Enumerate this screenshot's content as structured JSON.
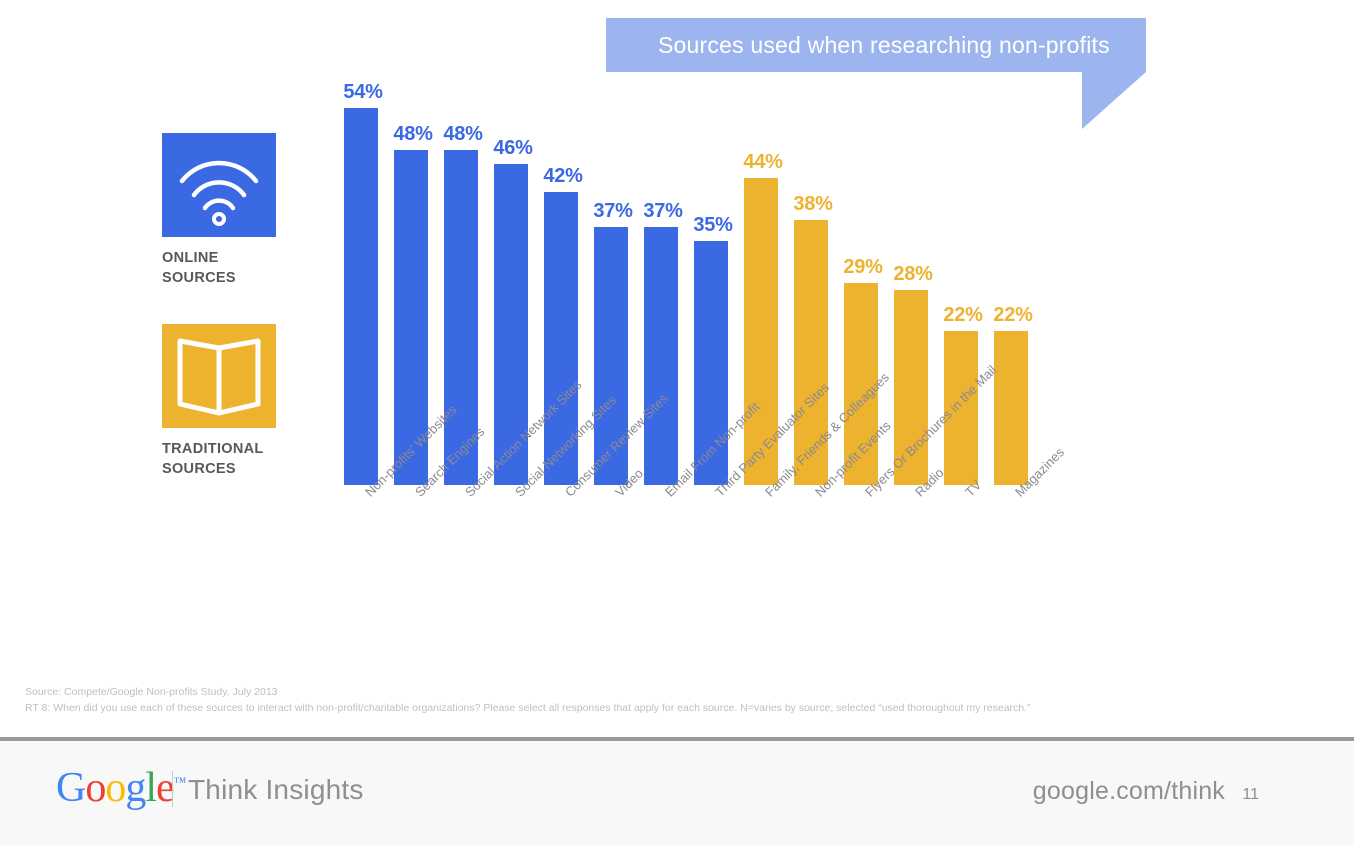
{
  "title": {
    "text": "Sources used when researching non-profits",
    "banner_color": "#9CB5EF",
    "text_color": "#FFFFFF"
  },
  "legend": {
    "items": [
      {
        "id": "online",
        "label": "ONLINE\nSOURCES",
        "icon": "wifi-icon",
        "color": "#3B68E3"
      },
      {
        "id": "traditional",
        "label": "TRADITIONAL\nSOURCES",
        "icon": "open-book-icon",
        "color": "#EDB22E"
      }
    ]
  },
  "chart_data": {
    "type": "bar",
    "title": "Sources used when researching non-profits",
    "xlabel": "",
    "ylabel": "",
    "ylim": [
      0,
      60
    ],
    "grid": false,
    "legend_position": "left",
    "value_suffix": "%",
    "categories": [
      "Non-profits' Websites",
      "Search Engines",
      "Social Action Network Sites",
      "Social Networking Sites",
      "Consumer Review Sites",
      "Video",
      "Email From Non-profit",
      "Third Party Evaluator Sites",
      "Family, Friends & Colleagues",
      "Non-profit Events",
      "Flyers Or Brochures in the Mail",
      "Radio",
      "TV",
      "Magazines"
    ],
    "values": [
      54,
      48,
      48,
      46,
      42,
      37,
      37,
      35,
      44,
      38,
      29,
      28,
      22,
      22
    ],
    "value_labels": [
      "54%",
      "48%",
      "48%",
      "46%",
      "42%",
      "37%",
      "37%",
      "35%",
      "44%",
      "38%",
      "29%",
      "28%",
      "22%",
      "22%"
    ],
    "groups": [
      "online",
      "online",
      "online",
      "online",
      "online",
      "online",
      "online",
      "online",
      "traditional",
      "traditional",
      "traditional",
      "traditional",
      "traditional",
      "traditional"
    ],
    "series": [
      {
        "name": "Online Sources",
        "color": "#3B68E3",
        "categories": [
          "Non-profits' Websites",
          "Search Engines",
          "Social Action Network Sites",
          "Social Networking Sites",
          "Consumer Review Sites",
          "Video",
          "Email From Non-profit",
          "Third Party Evaluator Sites"
        ],
        "values": [
          54,
          48,
          48,
          46,
          42,
          37,
          37,
          35
        ]
      },
      {
        "name": "Traditional Sources",
        "color": "#EDB22E",
        "categories": [
          "Family, Friends & Colleagues",
          "Non-profit Events",
          "Flyers Or Brochures in the Mail",
          "Radio",
          "TV",
          "Magazines"
        ],
        "values": [
          44,
          38,
          29,
          28,
          22,
          22
        ]
      }
    ]
  },
  "footnote": {
    "line1": "Source: Compete/Google Non-profits Study, July 2013",
    "line2": "RT 8: When did you use each of these sources to interact with non-profit/charitable organizations? Please select all responses that apply for each source. N=varies by source; selected “used thoroughout my research.”"
  },
  "footer": {
    "logo_letters": [
      "G",
      "o",
      "o",
      "g",
      "l",
      "e"
    ],
    "trademark": "™",
    "product": "Think Insights",
    "url": "google.com/think",
    "page_number": "11"
  }
}
